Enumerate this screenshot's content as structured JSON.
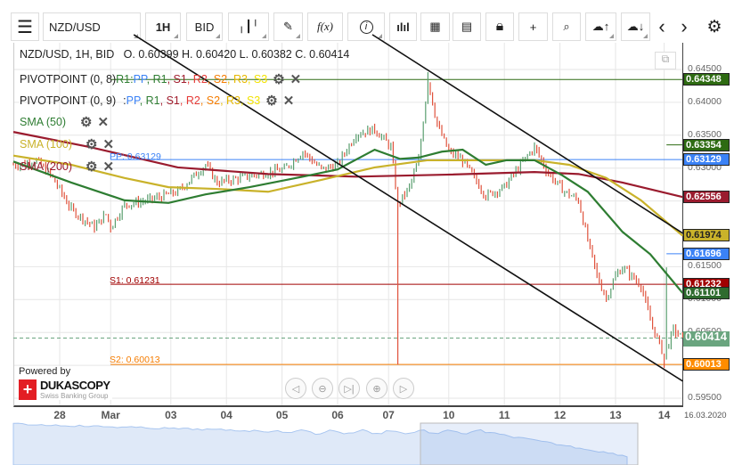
{
  "toolbar": {
    "symbol": "NZD/USD",
    "timeframe": "1H",
    "side": "BID",
    "fx": "f(x)",
    "prev": "‹",
    "next": "›"
  },
  "header": {
    "ohlc": "NZD/USD, 1H, BID   O. 0.60399 H. 0.60420 L. 0.60382 C. 0.60414"
  },
  "indicators": [
    {
      "name": "PIVOTPOINT (0, 8)",
      "overlap": "R1:"
    },
    {
      "name": "PIVOTPOINT (0, 9)",
      "overlap": ":"
    }
  ],
  "pivot_keys": [
    {
      "t": "PP",
      "c": "#3b82f6"
    },
    {
      "t": "R1",
      "c": "#2e7d32"
    },
    {
      "t": "S1",
      "c": "#a01c2c"
    },
    {
      "t": "R2",
      "c": "#e53935"
    },
    {
      "t": "S2",
      "c": "#f57c00"
    },
    {
      "t": "R3",
      "c": "#e6b800"
    },
    {
      "t": "S3",
      "c": "#f2e200"
    }
  ],
  "sma": [
    {
      "label": "SMA (50)",
      "color": "#2e7d32"
    },
    {
      "label": "SMA (100)",
      "color": "#c9b22a"
    },
    {
      "label": "SMA (200)",
      "color": "#9a1b2e"
    }
  ],
  "level_labels": {
    "pp": "PP: 0.63129",
    "s1": "S1: 0.61231",
    "s2": "S2: 0.60013"
  },
  "branding": {
    "powered": "Powered by",
    "name": "DUKASCOPY",
    "sub": "Swiss Banking Group"
  },
  "footer_date": "16.03.2020",
  "chart_data": {
    "type": "ohlc",
    "symbol": "NZD/USD",
    "interval": "1H",
    "ylim": [
      0.595,
      0.6475
    ],
    "y_ticks": [
      "0.64500",
      "0.64000",
      "0.63500",
      "0.63000",
      "0.62500",
      "0.62000",
      "0.61500",
      "0.61000",
      "0.60500",
      "0.60000",
      "0.59500"
    ],
    "x_labels": [
      {
        "t": "28",
        "bar": 20
      },
      {
        "t": "Mar",
        "bar": 42
      },
      {
        "t": "03",
        "bar": 68
      },
      {
        "t": "04",
        "bar": 92
      },
      {
        "t": "05",
        "bar": 116
      },
      {
        "t": "06",
        "bar": 140
      },
      {
        "t": "07",
        "bar": 162
      },
      {
        "t": "10",
        "bar": 188
      },
      {
        "t": "11",
        "bar": 212
      },
      {
        "t": "12",
        "bar": 236
      },
      {
        "t": "13",
        "bar": 260
      },
      {
        "t": "14",
        "bar": 281
      }
    ],
    "price_path": [
      [
        0,
        0.6305
      ],
      [
        2,
        0.6305
      ],
      [
        10,
        0.6312
      ],
      [
        17,
        0.6285
      ],
      [
        25,
        0.6237
      ],
      [
        35,
        0.621
      ],
      [
        40,
        0.623
      ],
      [
        42,
        0.621
      ],
      [
        48,
        0.6244
      ],
      [
        58,
        0.6251
      ],
      [
        71,
        0.6264
      ],
      [
        83,
        0.6305
      ],
      [
        88,
        0.6278
      ],
      [
        98,
        0.6285
      ],
      [
        117,
        0.6298
      ],
      [
        125,
        0.6325
      ],
      [
        133,
        0.6298
      ],
      [
        140,
        0.6305
      ],
      [
        148,
        0.6352
      ],
      [
        156,
        0.6359
      ],
      [
        163,
        0.6332
      ],
      [
        166,
        0.6244
      ],
      [
        171,
        0.6271
      ],
      [
        175,
        0.6312
      ],
      [
        179,
        0.6434
      ],
      [
        183,
        0.6366
      ],
      [
        188,
        0.6325
      ],
      [
        194,
        0.6312
      ],
      [
        204,
        0.6258
      ],
      [
        212,
        0.6271
      ],
      [
        219,
        0.6305
      ],
      [
        225,
        0.6332
      ],
      [
        231,
        0.6291
      ],
      [
        238,
        0.6264
      ],
      [
        244,
        0.6251
      ],
      [
        248,
        0.619
      ],
      [
        252,
        0.6136
      ],
      [
        256,
        0.6102
      ],
      [
        260,
        0.6136
      ],
      [
        263,
        0.6149
      ],
      [
        271,
        0.6122
      ],
      [
        275,
        0.6068
      ],
      [
        281,
        0.6014
      ],
      [
        285,
        0.6054
      ],
      [
        289,
        0.60414
      ]
    ],
    "spikes": [
      [
        166,
        0.6001
      ],
      [
        179,
        0.6446
      ],
      [
        281,
        0.5996
      ],
      [
        282,
        0.6149
      ]
    ],
    "sma50": [
      [
        0,
        0.631
      ],
      [
        25,
        0.6278
      ],
      [
        48,
        0.6251
      ],
      [
        67,
        0.6247
      ],
      [
        83,
        0.626
      ],
      [
        102,
        0.6271
      ],
      [
        125,
        0.6287
      ],
      [
        140,
        0.6298
      ],
      [
        156,
        0.6328
      ],
      [
        167,
        0.6314
      ],
      [
        175,
        0.6316
      ],
      [
        185,
        0.6325
      ],
      [
        194,
        0.6328
      ],
      [
        204,
        0.6305
      ],
      [
        213,
        0.6312
      ],
      [
        225,
        0.6312
      ],
      [
        237,
        0.6289
      ],
      [
        248,
        0.6264
      ],
      [
        263,
        0.6203
      ],
      [
        275,
        0.6169
      ],
      [
        289,
        0.611
      ]
    ],
    "sma100": [
      [
        0,
        0.6319
      ],
      [
        25,
        0.6305
      ],
      [
        48,
        0.6285
      ],
      [
        67,
        0.6271
      ],
      [
        90,
        0.6268
      ],
      [
        110,
        0.6264
      ],
      [
        133,
        0.6282
      ],
      [
        156,
        0.6301
      ],
      [
        179,
        0.6312
      ],
      [
        202,
        0.6312
      ],
      [
        225,
        0.6312
      ],
      [
        240,
        0.6305
      ],
      [
        256,
        0.6285
      ],
      [
        271,
        0.6251
      ],
      [
        289,
        0.6197
      ]
    ],
    "sma200": [
      [
        0,
        0.6355
      ],
      [
        33,
        0.6332
      ],
      [
        71,
        0.6301
      ],
      [
        110,
        0.6291
      ],
      [
        148,
        0.6287
      ],
      [
        187,
        0.629
      ],
      [
        225,
        0.6294
      ],
      [
        244,
        0.6291
      ],
      [
        263,
        0.6278
      ],
      [
        289,
        0.6256
      ]
    ],
    "trendlines": [
      [
        [
          52,
          0.6503
        ],
        [
          289,
          0.5976
        ]
      ],
      [
        [
          155,
          0.6503
        ],
        [
          289,
          0.6201
        ]
      ]
    ],
    "levels": [
      {
        "name": "R1",
        "price": 0.64348,
        "color": "#2e6b12",
        "from_bar": 42,
        "label": "0.64348"
      },
      {
        "name": "R1",
        "price": 0.63354,
        "color": "#2e6b12",
        "from_bar": 282,
        "label": "0.63354"
      },
      {
        "name": "PP",
        "price": 0.63129,
        "color": "#3b82f6",
        "from_bar": 42,
        "label": "0.63129"
      },
      {
        "name": "SMA200",
        "price": 0.62556,
        "color": "#9a1b2e",
        "from_bar": 999,
        "label": "0.62556"
      },
      {
        "name": "SMA100",
        "price": 0.61974,
        "color": "#c9b22a",
        "from_bar": 999,
        "label": "0.61974",
        "fg": "#222"
      },
      {
        "name": "PP",
        "price": 0.61696,
        "color": "#3b82f6",
        "from_bar": 282,
        "label": "0.61696"
      },
      {
        "name": "S1",
        "price": 0.61232,
        "color": "#a00000",
        "from_bar": 42,
        "label": "0.61232"
      },
      {
        "name": "SMA50",
        "price": 0.61101,
        "color": "#2e6b2e",
        "from_bar": 999,
        "label": "0.61101"
      },
      {
        "name": "Close",
        "price": 0.60414,
        "color": "#6aa57f",
        "from_bar": 0,
        "label": "0.60414",
        "dashed": true
      },
      {
        "name": "S2",
        "price": 0.60013,
        "color": "#f57c00",
        "from_bar": 42,
        "label": "0.60013"
      }
    ],
    "colors": {
      "up": "#5a9e6f",
      "down": "#e0533d"
    }
  }
}
